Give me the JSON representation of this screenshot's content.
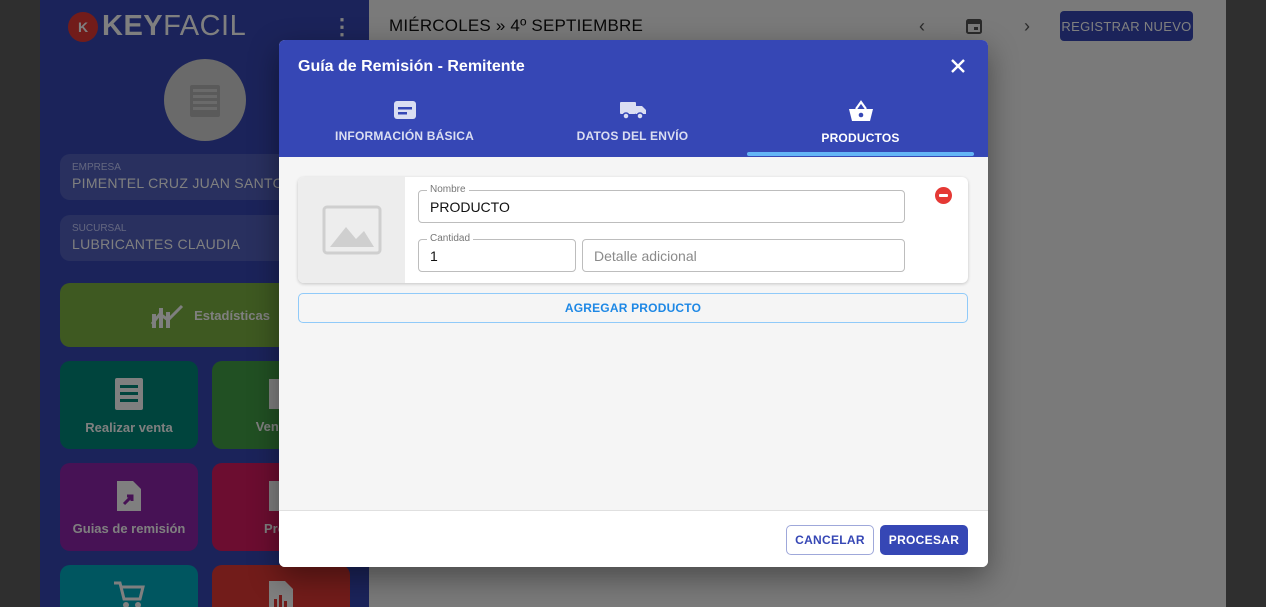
{
  "app": {
    "logo_badge": "K",
    "logo_bold": "KEY",
    "logo_light": "FACIL"
  },
  "sidebar": {
    "company": {
      "label": "EMPRESA",
      "value": "PIMENTEL CRUZ JUAN SANTOS"
    },
    "branch": {
      "label": "SUCURSAL",
      "value": "LUBRICANTES CLAUDIA"
    },
    "tiles": [
      {
        "label": "Estadísticas",
        "color": "#7cb342",
        "icon": "chart-icon"
      },
      {
        "label": "Realizar venta",
        "color": "#00897b",
        "icon": "receipt-icon"
      },
      {
        "label": "Ventas r",
        "color": "#43a047",
        "icon": "document-icon"
      },
      {
        "label": "Guias de remisión",
        "color": "#8e24aa",
        "icon": "file-arrow-icon"
      },
      {
        "label": "Profo",
        "color": "#d81b60",
        "icon": "document-icon"
      },
      {
        "label": "",
        "color": "#00acc1",
        "icon": "cart-icon"
      },
      {
        "label": "",
        "color": "#e53935",
        "icon": "report-icon"
      }
    ]
  },
  "topbar": {
    "date_title": "MIÉRCOLES » 4º SEPTIEMBRE",
    "register_label": "REGISTRAR NUEVO"
  },
  "modal": {
    "title": "Guía de Remisión - Remitente",
    "tabs": [
      {
        "label": "INFORMACIÓN BÁSICA",
        "icon": "card-text-icon",
        "active": false
      },
      {
        "label": "DATOS DEL ENVÍO",
        "icon": "truck-icon",
        "active": false
      },
      {
        "label": "PRODUCTOS",
        "icon": "basket-icon",
        "active": true
      }
    ],
    "product": {
      "name_label": "Nombre",
      "name_value": "PRODUCTO",
      "qty_label": "Cantidad",
      "qty_value": "1",
      "detail_placeholder": "Detalle adicional"
    },
    "add_product_label": "AGREGAR PRODUCTO",
    "cancel_label": "CANCELAR",
    "process_label": "PROCESAR"
  }
}
